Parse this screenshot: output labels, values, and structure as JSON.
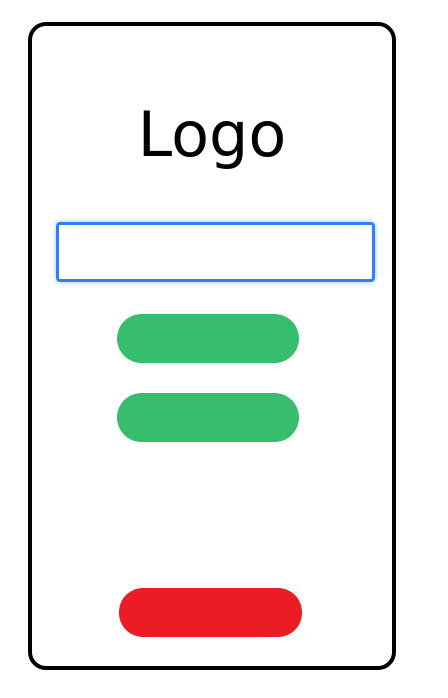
{
  "header": {
    "logo_text": "Logo"
  },
  "form": {
    "input_value": "",
    "input_placeholder": "",
    "primary_button_label": "",
    "secondary_button_label": ""
  },
  "footer": {
    "danger_button_label": ""
  },
  "colors": {
    "frame_border": "#000000",
    "input_border": "#2f80f5",
    "green_button": "#36bd6d",
    "red_button": "#ec1c24"
  }
}
